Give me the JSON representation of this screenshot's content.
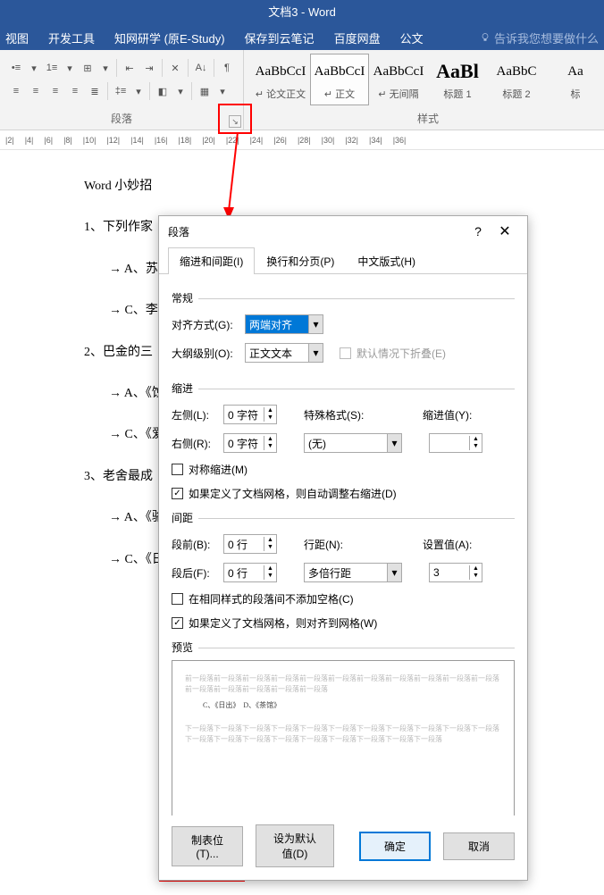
{
  "titlebar": "文档3 - Word",
  "menu": {
    "view": "视图",
    "dev": "开发工具",
    "estudy": "知网研学 (原E-Study)",
    "save": "保存到云笔记",
    "baidu": "百度网盘",
    "gongwen": "公文",
    "tell": "告诉我您想要做什么"
  },
  "ribbon": {
    "para_label": "段落",
    "styles_label": "样式",
    "styles": [
      {
        "sample": "AaBbCcI",
        "name": "↵ 论文正文"
      },
      {
        "sample": "AaBbCcI",
        "name": "↵ 正文"
      },
      {
        "sample": "AaBbCcI",
        "name": "↵ 无间隔"
      },
      {
        "sample": "AaBl",
        "name": "标题 1",
        "big": true
      },
      {
        "sample": "AaBbC",
        "name": "标题 2"
      },
      {
        "sample": "Aa",
        "name": "标"
      }
    ]
  },
  "ruler_marks": [
    "|2|",
    "|4|",
    "|6|",
    "|8|",
    "|10|",
    "|12|",
    "|14|",
    "|16|",
    "|18|",
    "|20|",
    "|22|",
    "|24|",
    "|26|",
    "|28|",
    "|30|",
    "|32|",
    "|34|",
    "|36|"
  ],
  "doc": {
    "l1": "Word 小妙招",
    "l2": "1、下列作家",
    "l3": "→ A、苏海",
    "l4": "→ C、李白",
    "l5": "2、巴金的三",
    "l6": "→ A、《蚀",
    "l7": "→ C、《爱情",
    "l8": "3、老舍最成",
    "l9": "→ A、《骆驼",
    "l10": "→ C、《日出"
  },
  "dialog": {
    "title": "段落",
    "tabs": {
      "t1": "缩进和间距(I)",
      "t2": "换行和分页(P)",
      "t3": "中文版式(H)"
    },
    "sec_general": "常规",
    "align_lbl": "对齐方式(G):",
    "align_val": "两端对齐",
    "outline_lbl": "大纲级别(O):",
    "outline_val": "正文文本",
    "collapse": "默认情况下折叠(E)",
    "sec_indent": "缩进",
    "left_lbl": "左侧(L):",
    "left_val": "0 字符",
    "right_lbl": "右侧(R):",
    "right_val": "0 字符",
    "special_lbl": "特殊格式(S):",
    "special_val": "(无)",
    "indentval_lbl": "缩进值(Y):",
    "indentval_val": "",
    "mirror": "对称缩进(M)",
    "autogrid": "如果定义了文档网格，则自动调整右缩进(D)",
    "sec_spacing": "间距",
    "before_lbl": "段前(B):",
    "before_val": "0 行",
    "after_lbl": "段后(F):",
    "after_val": "0 行",
    "linespace_lbl": "行距(N):",
    "linespace_val": "多倍行距",
    "setat_lbl": "设置值(A):",
    "setat_val": "3",
    "noextra": "在相同样式的段落间不添加空格(C)",
    "snapgrid": "如果定义了文档网格，则对齐到网格(W)",
    "sec_preview": "预览",
    "preview_grey1": "前一段落前一段落前一段落前一段落前一段落前一段落前一段落前一段落前一段落前一段落前一段落前一段落前一段落前一段落前一段落前一段落",
    "preview_dark": "C、《日出》　D、《茶馆》",
    "preview_grey2": "下一段落下一段落下一段落下一段落下一段落下一段落下一段落下一段落下一段落下一段落下一段落下一段落下一段落下一段落下一段落下一段落下一段落下一段落下一段落下一段落",
    "btn_tabs": "制表位(T)...",
    "btn_default": "设为默认值(D)",
    "btn_ok": "确定",
    "btn_cancel": "取消"
  }
}
